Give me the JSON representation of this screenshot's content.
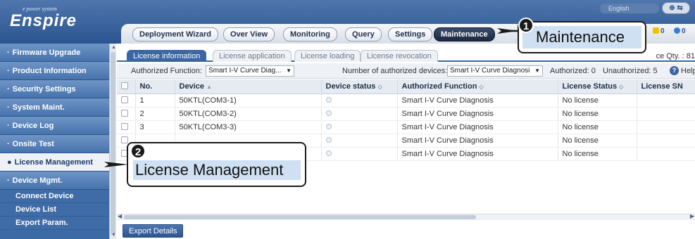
{
  "header": {
    "logo_sub": "e power system",
    "logo_main": "Enspire",
    "language": "English",
    "nav_tabs": [
      {
        "label": "Deployment Wizard"
      },
      {
        "label": "Over View"
      },
      {
        "label": "Monitoring"
      },
      {
        "label": "Query"
      },
      {
        "label": "Settings"
      },
      {
        "label": "Maintenance",
        "active": true
      }
    ],
    "alarm_counts": [
      "0",
      "0"
    ],
    "alarm_colors": [
      "#f2c200",
      "#3a7ad6"
    ]
  },
  "sidebar": {
    "items": [
      {
        "label": "Firmware Upgrade"
      },
      {
        "label": "Product Information"
      },
      {
        "label": "Security Settings"
      },
      {
        "label": "System Maint."
      },
      {
        "label": "Device Log"
      },
      {
        "label": "Onsite Test"
      },
      {
        "label": "License Management",
        "active": true
      },
      {
        "label": "Device Mgmt."
      }
    ],
    "sub_items": [
      {
        "label": "Connect Device"
      },
      {
        "label": "Device List"
      },
      {
        "label": "Export Param."
      }
    ]
  },
  "content": {
    "subtabs": [
      {
        "label": "License information",
        "active": true
      },
      {
        "label": "License application"
      },
      {
        "label": "License loading"
      },
      {
        "label": "License revocation"
      }
    ],
    "qty_label": "ce Qty. : 81",
    "filter": {
      "authorized_function_label": "Authorized Function:",
      "authorized_function_value": "Smart I-V Curve Diag...",
      "num_devices_label": "Number of authorized devices:",
      "num_devices_value": "Smart I-V Curve Diagnosi",
      "authorized_text": "Authorized: 0",
      "unauthorized_text": "Unauthorized: 5",
      "help_label": "Help"
    },
    "table": {
      "columns": [
        "No.",
        "Device",
        "Device status",
        "Authorized Function",
        "License Status",
        "License SN"
      ],
      "rows": [
        {
          "no": "1",
          "device": "50KTL(COM3-1)",
          "function": "Smart I-V Curve Diagnosis",
          "license_status": "No license"
        },
        {
          "no": "2",
          "device": "50KTL(COM3-2)",
          "function": "Smart I-V Curve Diagnosis",
          "license_status": "No license"
        },
        {
          "no": "3",
          "device": "50KTL(COM3-3)",
          "function": "Smart I-V Curve Diagnosis",
          "license_status": "No license"
        },
        {
          "no": "",
          "device": "",
          "function": "Smart I-V Curve Diagnosis",
          "license_status": "No license"
        },
        {
          "no": "",
          "device": "",
          "function": "Smart I-V Curve Diagnosis",
          "license_status": "No license"
        }
      ]
    },
    "export_button": "Export Details"
  },
  "callouts": {
    "one": {
      "number": "1",
      "text": "Maintenance"
    },
    "two": {
      "number": "2",
      "text": "License Management"
    }
  },
  "colors": {
    "header_blue": "#2b5590",
    "sidebar_blue": "#3c6aa4",
    "accent": "#3a66a2"
  }
}
